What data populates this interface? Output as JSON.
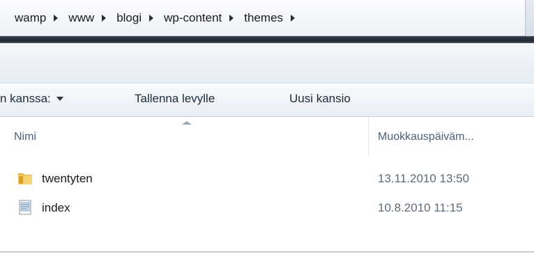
{
  "breadcrumb": {
    "items": [
      "wamp",
      "www",
      "blogi",
      "wp-content",
      "themes"
    ]
  },
  "commandbar": {
    "share_label": "n kanssa:",
    "save_label": "Tallenna levylle",
    "new_folder_label": "Uusi kansio"
  },
  "columns": {
    "name": "Nimi",
    "date_modified": "Muokkauspäiväm..."
  },
  "files": [
    {
      "name": "twentyten",
      "date": "13.11.2010 13:50",
      "icon": "folder-icon"
    },
    {
      "name": "index",
      "date": "10.8.2010 11:15",
      "icon": "file-icon"
    }
  ]
}
